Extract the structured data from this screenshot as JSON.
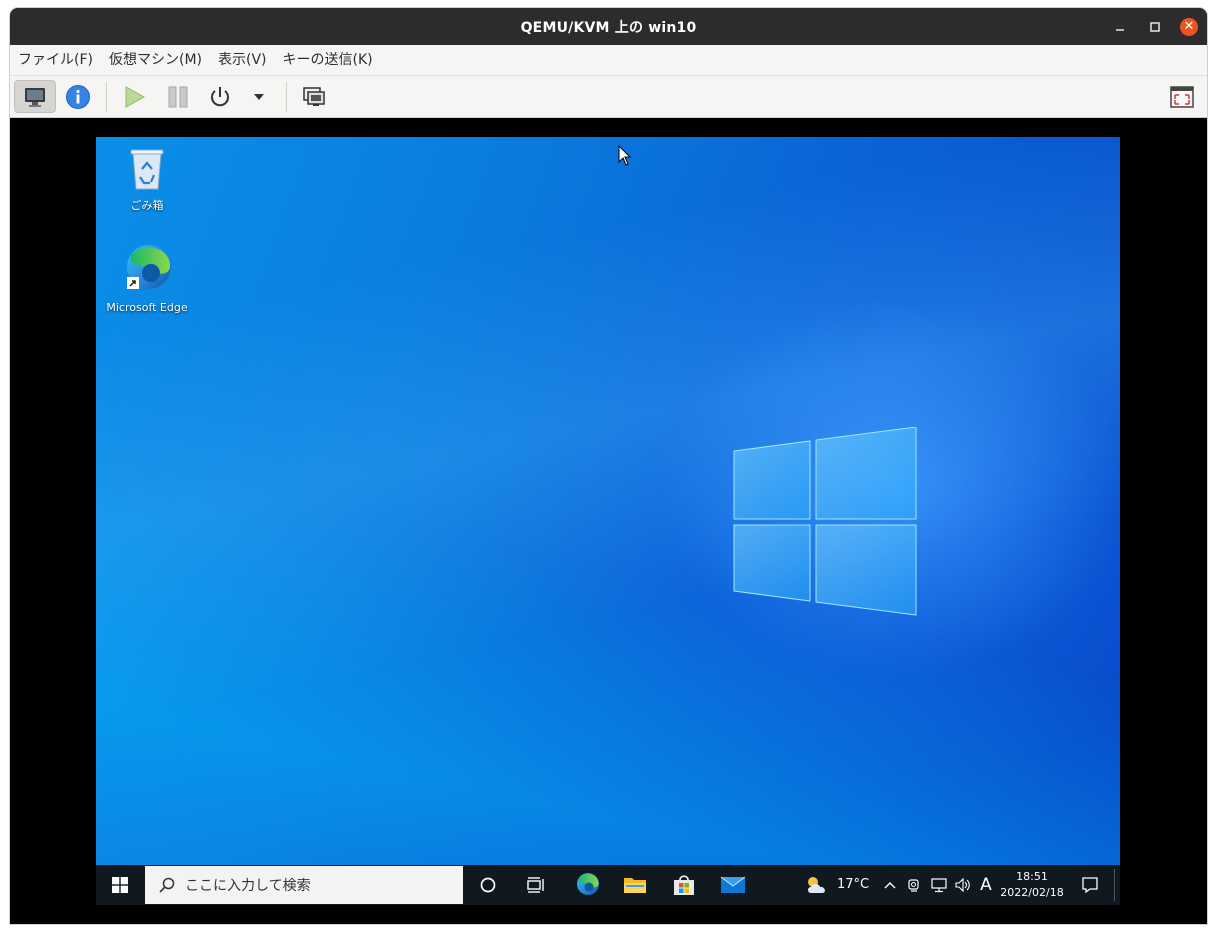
{
  "window": {
    "title": "QEMU/KVM 上の win10"
  },
  "menu": [
    "ファイル(F)",
    "仮想マシン(M)",
    "表示(V)",
    "キーの送信(K)"
  ],
  "desktop": {
    "icons": [
      {
        "label": "ごみ箱",
        "icon": "recycle-bin-icon"
      },
      {
        "label": "Microsoft Edge",
        "icon": "edge-icon"
      }
    ]
  },
  "taskbar": {
    "search_placeholder": "ここに入力して検索",
    "temperature": "17°C",
    "ime": "A",
    "time": "18:51",
    "date": "2022/02/18"
  },
  "colors": {
    "titlebar": "#2c2c2c",
    "close_button": "#e95420",
    "desktop_blue": "#0a63d6",
    "taskbar": "#101820"
  }
}
